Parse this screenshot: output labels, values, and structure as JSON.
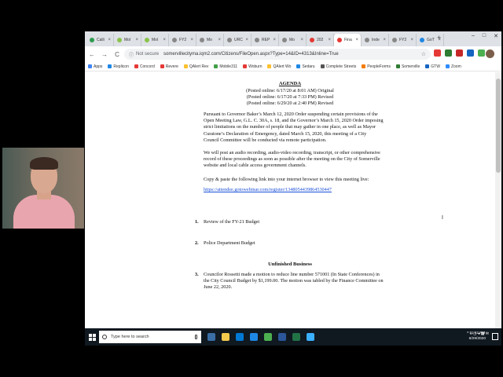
{
  "browser": {
    "tabs": [
      {
        "label": "Calli",
        "color": "#2e9b4f"
      },
      {
        "label": "Mol",
        "color": "#8bc34a"
      },
      {
        "label": "Mol",
        "color": "#8bc34a"
      },
      {
        "label": "FY2",
        "color": "#888888"
      },
      {
        "label": "Mo",
        "color": "#888888"
      },
      {
        "label": "URC",
        "color": "#888888"
      },
      {
        "label": "REP",
        "color": "#888888"
      },
      {
        "label": "Mo",
        "color": "#888888"
      },
      {
        "label": "202",
        "color": "#e53935"
      },
      {
        "label": "Fina",
        "color": "#e53935"
      },
      {
        "label": "Inde",
        "color": "#888888"
      },
      {
        "label": "FY2",
        "color": "#888888"
      },
      {
        "label": "GoT",
        "color": "#1e88e5"
      }
    ],
    "new_tab": "+",
    "window_controls": {
      "minimize": "–",
      "maximize": "□",
      "close": "✕"
    },
    "nav": {
      "back": "←",
      "forward": "→",
      "reload": "C",
      "home": "⌂"
    },
    "address": {
      "info_icon": "info-icon",
      "security_label": "Not secure",
      "url": "somervillecityma.iqm2.com/Citizens/FileOpen.aspx?Type=14&ID=4313&Inline=True",
      "star_icon": "star-icon"
    },
    "extension_colors": [
      "#e53935",
      "#2e7d32",
      "#c62828",
      "#1565c0",
      "#4caf50",
      "#ef6c00",
      "#6a1b9a",
      "#00897b",
      "#37474f"
    ],
    "bookmarks": [
      {
        "label": "Apps",
        "color": "#4285f4"
      },
      {
        "label": "Replicon",
        "color": "#1e88e5"
      },
      {
        "label": "Concord",
        "color": "#e53935"
      },
      {
        "label": "Revere",
        "color": "#e53935"
      },
      {
        "label": "QAlert Rev",
        "color": "#fbc02d"
      },
      {
        "label": "Mobile311",
        "color": "#43a047"
      },
      {
        "label": "Woburn",
        "color": "#e53935"
      },
      {
        "label": "QAlert Wo",
        "color": "#fbc02d"
      },
      {
        "label": "Sedaru",
        "color": "#1e88e5"
      },
      {
        "label": "Complete Streets",
        "color": "#555555"
      },
      {
        "label": "PeopleForms",
        "color": "#f57c00"
      },
      {
        "label": "Somerville",
        "color": "#2e7d32"
      },
      {
        "label": "GTW",
        "color": "#1565c0"
      },
      {
        "label": "Zoom",
        "color": "#2d8cff"
      }
    ]
  },
  "document": {
    "title": "AGENDA",
    "posted": [
      "(Posted online: 6/17/20 at 8:01 AM) Original",
      "(Posted online: 6/17/20 at 7:33 PM) Revised",
      "(Posted online: 6/29/20 at 2:40 PM) Revised"
    ],
    "para1": [
      "Pursuant to Governor Baker’s March 12, 2020 Order suspending certain provisions of the",
      "Open Meeting Law, G.L. C. 30A, s. 18, and the Governor’s March 15, 2020 Order imposing",
      "strict limitations on the number of people that may gather in one place, as well as Mayor",
      "Curatone’s Declaration of Emergency, dated March 15, 2020, this meeting of a City",
      "Council Committee will be conducted via remote participation."
    ],
    "para2": [
      "We will post an audio recording, audio-video recording, transcript, or other comprehensive",
      "record of these proceedings as soon as possible after the meeting on the City of Somerville",
      "website and local cable access government channels."
    ],
    "para3": "Copy & paste the following link into your internet browser to view this meeting live:",
    "link": "https://attendee.gotowebinar.com/register/1348054439864530447",
    "items": [
      {
        "num": "1.",
        "text": "Review of the FY-21 Budget"
      },
      {
        "num": "2.",
        "text": "Police Department Budget"
      }
    ],
    "section": "Unfinished Business",
    "item3": {
      "num": "3.",
      "lines": [
        "Councilor Rossetti made a motion to reduce line number 571001 (In State Conferences) in",
        "the City Council Budget by $1,199.00. The motion was tabled by the Finance Committee on",
        "June 22, 2020."
      ]
    }
  },
  "taskbar": {
    "search_placeholder": "Type here to search",
    "app_colors": [
      "#3a6ea5",
      "#f2c94c",
      "#0078d4",
      "#1e88e5",
      "#4caf50",
      "#2b579a",
      "#217346",
      "#3ab0ff"
    ],
    "tray": "^ ⌂ ◻ ◂ ▦ ✉",
    "time": "11:52 PM",
    "date": "6/29/2020"
  }
}
